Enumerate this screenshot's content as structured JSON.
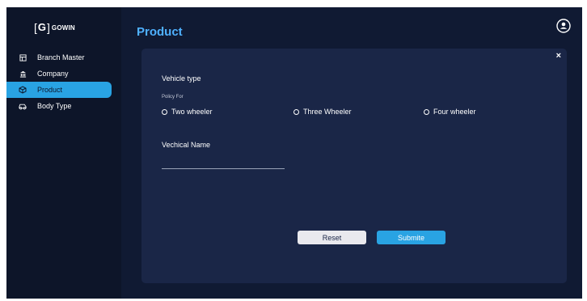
{
  "brand": {
    "bracket_open": "[",
    "letter": "G",
    "bracket_close": "]",
    "name": "GOWIN"
  },
  "sidebar": {
    "items": [
      {
        "label": "Branch Master",
        "icon": "branch-icon",
        "active": false
      },
      {
        "label": "Company",
        "icon": "building-icon",
        "active": false
      },
      {
        "label": "Product",
        "icon": "box-icon",
        "active": true
      },
      {
        "label": "Body Type",
        "icon": "car-icon",
        "active": false
      }
    ]
  },
  "header": {
    "title": "Product",
    "user_icon": "user-icon"
  },
  "form": {
    "close_label": "×",
    "section_title": "Vehicle type",
    "policy_label": "Policy For",
    "policy_options": [
      "Two wheeler",
      "Three Wheeler",
      "Four wheeler"
    ],
    "name_label": "Vechical Name",
    "name_value": "",
    "reset_label": "Reset",
    "submit_label": "Submite"
  },
  "colors": {
    "sidebar_bg": "#0d1529",
    "main_bg": "#101a33",
    "card_bg": "#1a2647",
    "accent": "#29a3e3",
    "title": "#4fb1ff"
  }
}
